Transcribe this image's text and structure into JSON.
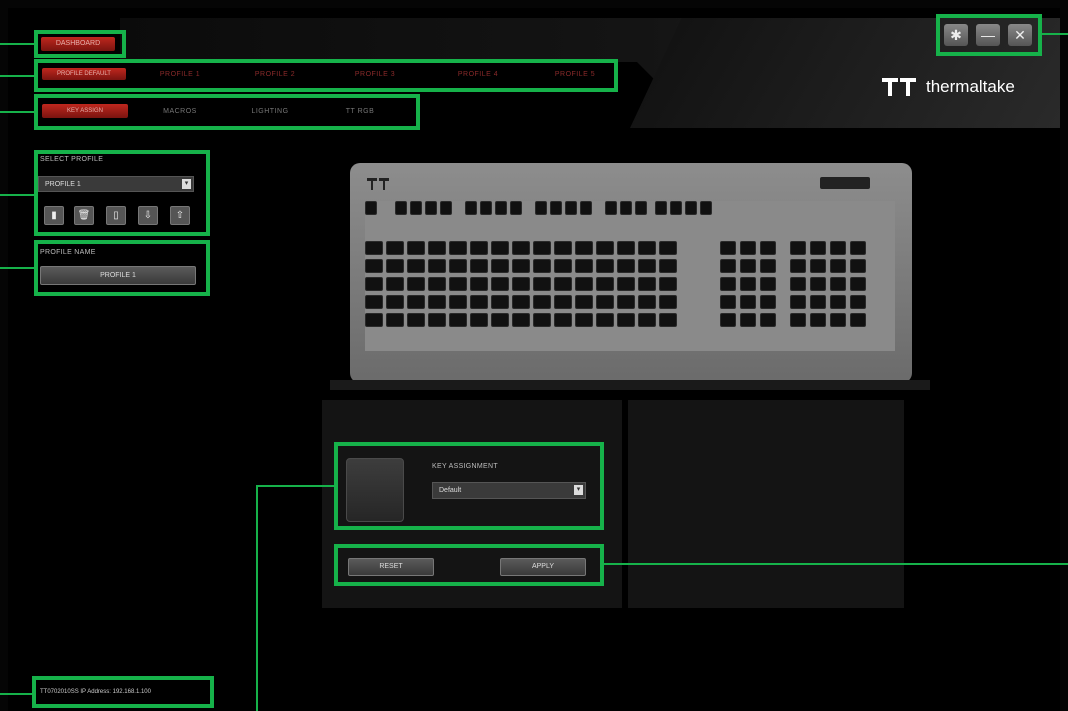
{
  "app": {
    "brand_name": "thermaltake",
    "top_button": "DASHBOARD"
  },
  "window_controls": {
    "settings": "✱",
    "minimize": "—",
    "close": "✕"
  },
  "profile_tabs": [
    "PROFILE DEFAULT",
    "PROFILE 1",
    "PROFILE 2",
    "PROFILE 3",
    "PROFILE 4",
    "PROFILE 5"
  ],
  "function_tabs": [
    "KEY ASSIGN",
    "MACROS",
    "LIGHTING",
    "TT RGB"
  ],
  "select_profile": {
    "label": "SELECT PROFILE",
    "value": "PROFILE 1",
    "actions": [
      "new",
      "delete",
      "copy",
      "import",
      "export"
    ]
  },
  "profile_name": {
    "label": "PROFILE NAME",
    "value": "PROFILE 1"
  },
  "key_assignment": {
    "label": "KEY ASSIGNMENT",
    "value": "Default"
  },
  "buttons": {
    "reset": "RESET",
    "apply": "APPLY"
  },
  "status_bar": {
    "text": "TT0702010SS  IP Address: 192.168.1.100"
  },
  "colors": {
    "highlight": "#16b24a",
    "accent_red": "#c0271e"
  }
}
